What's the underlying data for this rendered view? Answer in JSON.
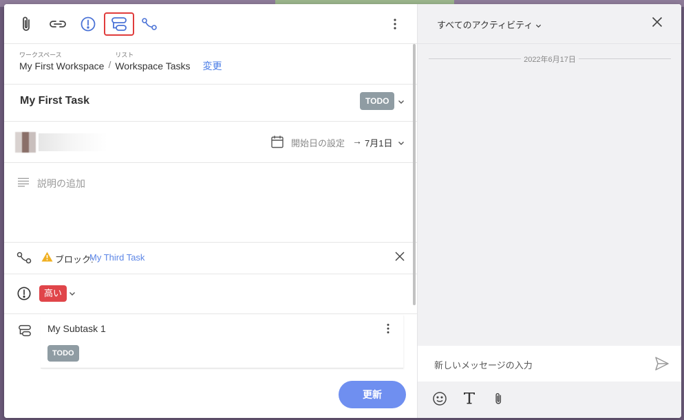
{
  "toolbar": {
    "buttons": [
      "attachment-icon",
      "link-icon",
      "priority-icon",
      "subtask-icon",
      "dependency-icon"
    ],
    "active_button": "subtask-icon",
    "more": "more-vertical-icon"
  },
  "breadcrumb": {
    "workspace_label": "ワークスペース",
    "workspace_value": "My First Workspace",
    "separator": "/",
    "list_label": "リスト",
    "list_value": "Workspace Tasks",
    "change_link": "変更"
  },
  "task": {
    "title": "My First Task",
    "status": "TODO",
    "status_color": "#8f9ca3"
  },
  "dates": {
    "start_placeholder": "開始日の設定",
    "arrow": "→",
    "end": "7月1日"
  },
  "description": {
    "placeholder": "説明の追加"
  },
  "blocking": {
    "label": "ブロック:",
    "task": "My Third Task",
    "link_color": "#5b85e6"
  },
  "priority": {
    "value": "高い",
    "color": "#e0454a"
  },
  "subtask": {
    "name": "My Subtask 1",
    "status": "TODO"
  },
  "update_button": "更新",
  "activity": {
    "filter": "すべてのアクティビティ",
    "date_divider": "2022年6月17日",
    "message_placeholder": "新しいメッセージの入力",
    "tools": [
      "emoji-icon",
      "text-format-icon",
      "attachment-icon"
    ]
  },
  "colors": {
    "accent": "#6f8ff0",
    "highlight_border": "#e03b3b"
  }
}
